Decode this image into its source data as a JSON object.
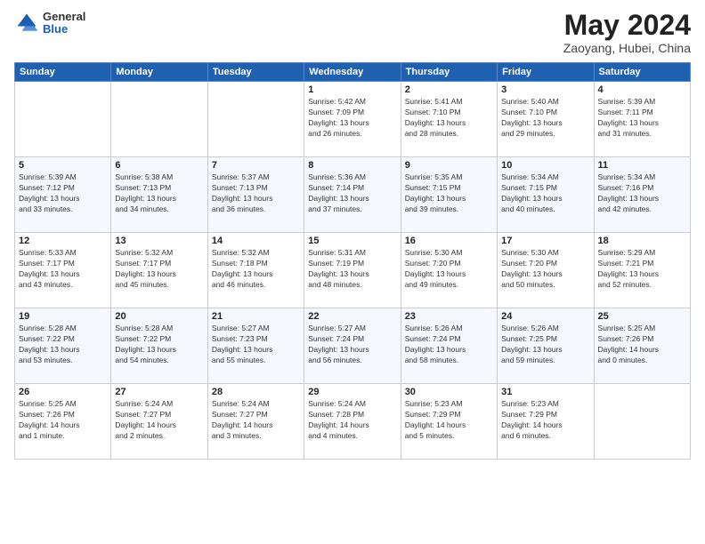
{
  "logo": {
    "general": "General",
    "blue": "Blue"
  },
  "title": {
    "month_year": "May 2024",
    "location": "Zaoyang, Hubei, China"
  },
  "weekdays": [
    "Sunday",
    "Monday",
    "Tuesday",
    "Wednesday",
    "Thursday",
    "Friday",
    "Saturday"
  ],
  "weeks": [
    [
      {
        "day": "",
        "info": ""
      },
      {
        "day": "",
        "info": ""
      },
      {
        "day": "",
        "info": ""
      },
      {
        "day": "1",
        "info": "Sunrise: 5:42 AM\nSunset: 7:09 PM\nDaylight: 13 hours\nand 26 minutes."
      },
      {
        "day": "2",
        "info": "Sunrise: 5:41 AM\nSunset: 7:10 PM\nDaylight: 13 hours\nand 28 minutes."
      },
      {
        "day": "3",
        "info": "Sunrise: 5:40 AM\nSunset: 7:10 PM\nDaylight: 13 hours\nand 29 minutes."
      },
      {
        "day": "4",
        "info": "Sunrise: 5:39 AM\nSunset: 7:11 PM\nDaylight: 13 hours\nand 31 minutes."
      }
    ],
    [
      {
        "day": "5",
        "info": "Sunrise: 5:39 AM\nSunset: 7:12 PM\nDaylight: 13 hours\nand 33 minutes."
      },
      {
        "day": "6",
        "info": "Sunrise: 5:38 AM\nSunset: 7:13 PM\nDaylight: 13 hours\nand 34 minutes."
      },
      {
        "day": "7",
        "info": "Sunrise: 5:37 AM\nSunset: 7:13 PM\nDaylight: 13 hours\nand 36 minutes."
      },
      {
        "day": "8",
        "info": "Sunrise: 5:36 AM\nSunset: 7:14 PM\nDaylight: 13 hours\nand 37 minutes."
      },
      {
        "day": "9",
        "info": "Sunrise: 5:35 AM\nSunset: 7:15 PM\nDaylight: 13 hours\nand 39 minutes."
      },
      {
        "day": "10",
        "info": "Sunrise: 5:34 AM\nSunset: 7:15 PM\nDaylight: 13 hours\nand 40 minutes."
      },
      {
        "day": "11",
        "info": "Sunrise: 5:34 AM\nSunset: 7:16 PM\nDaylight: 13 hours\nand 42 minutes."
      }
    ],
    [
      {
        "day": "12",
        "info": "Sunrise: 5:33 AM\nSunset: 7:17 PM\nDaylight: 13 hours\nand 43 minutes."
      },
      {
        "day": "13",
        "info": "Sunrise: 5:32 AM\nSunset: 7:17 PM\nDaylight: 13 hours\nand 45 minutes."
      },
      {
        "day": "14",
        "info": "Sunrise: 5:32 AM\nSunset: 7:18 PM\nDaylight: 13 hours\nand 46 minutes."
      },
      {
        "day": "15",
        "info": "Sunrise: 5:31 AM\nSunset: 7:19 PM\nDaylight: 13 hours\nand 48 minutes."
      },
      {
        "day": "16",
        "info": "Sunrise: 5:30 AM\nSunset: 7:20 PM\nDaylight: 13 hours\nand 49 minutes."
      },
      {
        "day": "17",
        "info": "Sunrise: 5:30 AM\nSunset: 7:20 PM\nDaylight: 13 hours\nand 50 minutes."
      },
      {
        "day": "18",
        "info": "Sunrise: 5:29 AM\nSunset: 7:21 PM\nDaylight: 13 hours\nand 52 minutes."
      }
    ],
    [
      {
        "day": "19",
        "info": "Sunrise: 5:28 AM\nSunset: 7:22 PM\nDaylight: 13 hours\nand 53 minutes."
      },
      {
        "day": "20",
        "info": "Sunrise: 5:28 AM\nSunset: 7:22 PM\nDaylight: 13 hours\nand 54 minutes."
      },
      {
        "day": "21",
        "info": "Sunrise: 5:27 AM\nSunset: 7:23 PM\nDaylight: 13 hours\nand 55 minutes."
      },
      {
        "day": "22",
        "info": "Sunrise: 5:27 AM\nSunset: 7:24 PM\nDaylight: 13 hours\nand 56 minutes."
      },
      {
        "day": "23",
        "info": "Sunrise: 5:26 AM\nSunset: 7:24 PM\nDaylight: 13 hours\nand 58 minutes."
      },
      {
        "day": "24",
        "info": "Sunrise: 5:26 AM\nSunset: 7:25 PM\nDaylight: 13 hours\nand 59 minutes."
      },
      {
        "day": "25",
        "info": "Sunrise: 5:25 AM\nSunset: 7:26 PM\nDaylight: 14 hours\nand 0 minutes."
      }
    ],
    [
      {
        "day": "26",
        "info": "Sunrise: 5:25 AM\nSunset: 7:26 PM\nDaylight: 14 hours\nand 1 minute."
      },
      {
        "day": "27",
        "info": "Sunrise: 5:24 AM\nSunset: 7:27 PM\nDaylight: 14 hours\nand 2 minutes."
      },
      {
        "day": "28",
        "info": "Sunrise: 5:24 AM\nSunset: 7:27 PM\nDaylight: 14 hours\nand 3 minutes."
      },
      {
        "day": "29",
        "info": "Sunrise: 5:24 AM\nSunset: 7:28 PM\nDaylight: 14 hours\nand 4 minutes."
      },
      {
        "day": "30",
        "info": "Sunrise: 5:23 AM\nSunset: 7:29 PM\nDaylight: 14 hours\nand 5 minutes."
      },
      {
        "day": "31",
        "info": "Sunrise: 5:23 AM\nSunset: 7:29 PM\nDaylight: 14 hours\nand 6 minutes."
      },
      {
        "day": "",
        "info": ""
      }
    ]
  ]
}
